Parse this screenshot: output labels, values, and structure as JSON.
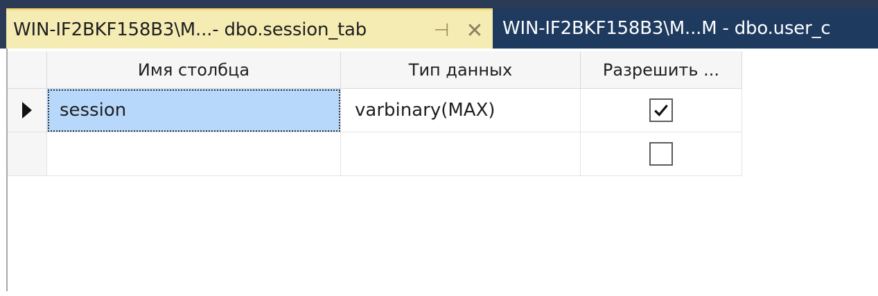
{
  "tabs": [
    {
      "title": "WIN-IF2BKF158B3\\M...- dbo.session_tab",
      "active": true,
      "pin_glyph": "⊣",
      "close_glyph": "✕"
    },
    {
      "title": "WIN-IF2BKF158B3\\M...M - dbo.user_c",
      "active": false
    }
  ],
  "grid": {
    "columns": [
      "Имя столбца",
      "Тип данных",
      "Разрешить ..."
    ],
    "rows": [
      {
        "name": "session",
        "type": "varbinary(MAX)",
        "allow_nulls": true,
        "current": true
      },
      {
        "name": "",
        "type": "",
        "allow_nulls": false,
        "current": false
      }
    ]
  },
  "colors": {
    "active_tab": "#f5ecb4",
    "inactive_tab": "#1e3a5f",
    "selection": "#b7d8fb"
  }
}
